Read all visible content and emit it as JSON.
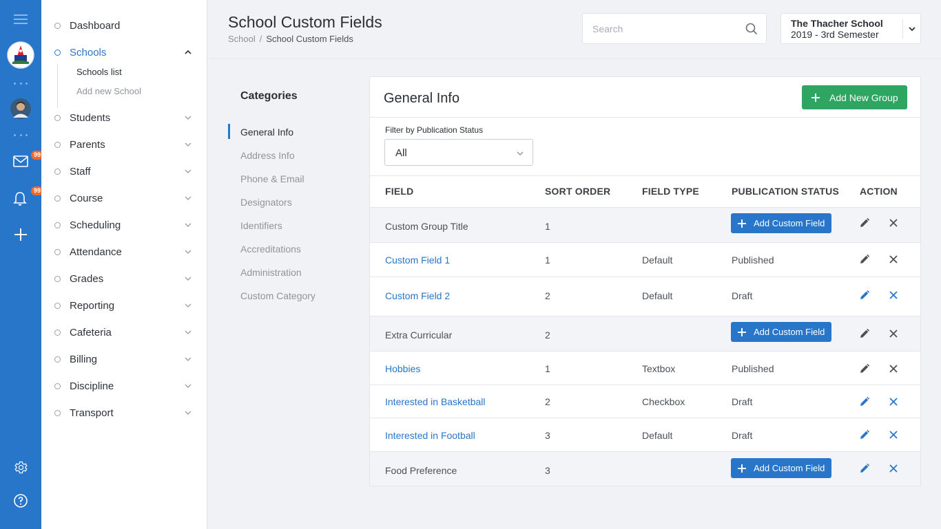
{
  "header": {
    "title": "School Custom Fields",
    "breadcrumb": [
      "School",
      "School Custom Fields"
    ],
    "breadcrumb_sep": "/",
    "search_placeholder": "Search",
    "school": {
      "name": "The Thacher School",
      "term": "2019 - 3rd Semester"
    }
  },
  "rail": {
    "mail_badge": "99",
    "bell_badge": "99"
  },
  "sidebar": {
    "items": [
      {
        "label": "Dashboard"
      },
      {
        "label": "Schools"
      },
      {
        "label": "Students"
      },
      {
        "label": "Parents"
      },
      {
        "label": "Staff"
      },
      {
        "label": "Course"
      },
      {
        "label": "Scheduling"
      },
      {
        "label": "Attendance"
      },
      {
        "label": "Grades"
      },
      {
        "label": "Reporting"
      },
      {
        "label": "Cafeteria"
      },
      {
        "label": "Billing"
      },
      {
        "label": "Discipline"
      },
      {
        "label": "Transport"
      }
    ],
    "sub_items": [
      "Schools list",
      "Add new School"
    ]
  },
  "categories": {
    "title": "Categories",
    "items": [
      "General Info",
      "Address Info",
      "Phone & Email",
      "Designators",
      "Identifiers",
      "Accreditations",
      "Administration",
      "Custom Category"
    ]
  },
  "card": {
    "title": "General Info",
    "add_group_label": "Add New Group",
    "filter_label": "Filter by Publication Status",
    "filter_value": "All",
    "columns": [
      "FIELD",
      "SORT ORDER",
      "FIELD TYPE",
      "PUBLICATION STATUS",
      "ACTION"
    ],
    "add_field_label": "Add Custom Field",
    "rows": [
      {
        "field": "Custom Group Title",
        "sort": "1",
        "type": "",
        "status": ""
      },
      {
        "field": "Custom Field 1",
        "sort": "1",
        "type": "Default",
        "status": "Published"
      },
      {
        "field": "Custom Field 2",
        "sort": "2",
        "type": "Default",
        "status": "Draft"
      },
      {
        "field": "Extra Curricular",
        "sort": "2",
        "type": "",
        "status": ""
      },
      {
        "field": "Hobbies",
        "sort": "1",
        "type": "Textbox",
        "status": "Published"
      },
      {
        "field": "Interested in Basketball",
        "sort": "2",
        "type": "Checkbox",
        "status": "Draft"
      },
      {
        "field": "Interested in Football",
        "sort": "3",
        "type": "Default",
        "status": "Draft"
      },
      {
        "field": "Food Preference",
        "sort": "3",
        "type": "",
        "status": ""
      }
    ]
  },
  "colors": {
    "primary": "#2876c9",
    "success": "#2fa562",
    "badge": "#f06a2a"
  }
}
